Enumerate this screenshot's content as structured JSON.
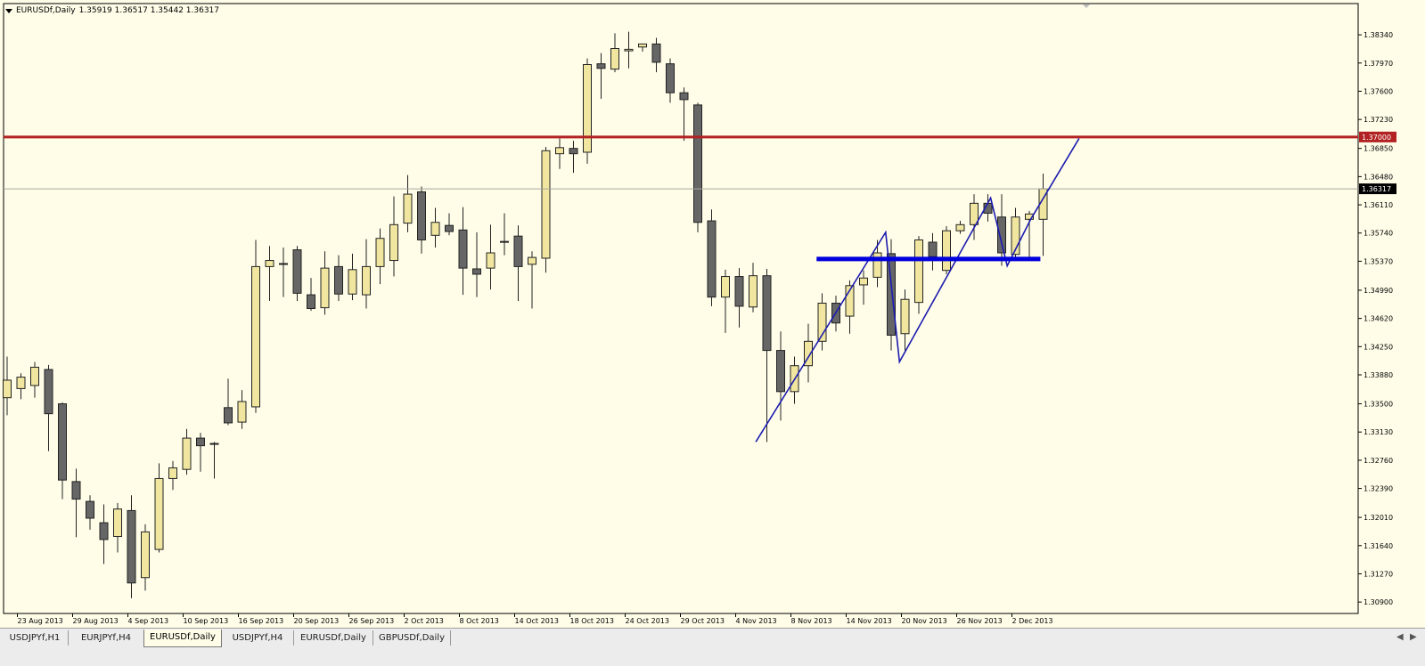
{
  "header": {
    "symbol": "EURUSDf,Daily",
    "ohlc": "1.35919 1.36517 1.35442 1.36317"
  },
  "chart_data": {
    "type": "candlestick",
    "symbol": "EURUSDf",
    "timeframe": "Daily",
    "ylim": [
      1.3075,
      1.3875
    ],
    "y_ticks": [
      "1.38340",
      "1.37970",
      "1.37600",
      "1.37230",
      "1.36850",
      "1.36480",
      "1.36110",
      "1.35740",
      "1.35370",
      "1.34990",
      "1.34620",
      "1.34250",
      "1.33880",
      "1.33500",
      "1.33130",
      "1.32760",
      "1.32390",
      "1.32010",
      "1.31640",
      "1.31270",
      "1.30900"
    ],
    "x_tick_labels": [
      {
        "bar": 1,
        "label": "23 Aug 2013"
      },
      {
        "bar": 5,
        "label": "29 Aug 2013"
      },
      {
        "bar": 9,
        "label": "4 Sep 2013"
      },
      {
        "bar": 13,
        "label": "10 Sep 2013"
      },
      {
        "bar": 17,
        "label": "16 Sep 2013"
      },
      {
        "bar": 21,
        "label": "20 Sep 2013"
      },
      {
        "bar": 25,
        "label": "26 Sep 2013"
      },
      {
        "bar": 29,
        "label": "2 Oct 2013"
      },
      {
        "bar": 33,
        "label": "8 Oct 2013"
      },
      {
        "bar": 37,
        "label": "14 Oct 2013"
      },
      {
        "bar": 41,
        "label": "18 Oct 2013"
      },
      {
        "bar": 45,
        "label": "24 Oct 2013"
      },
      {
        "bar": 49,
        "label": "29 Oct 2013"
      },
      {
        "bar": 53,
        "label": "4 Nov 2013"
      },
      {
        "bar": 57,
        "label": "8 Nov 2013"
      },
      {
        "bar": 61,
        "label": "14 Nov 2013"
      },
      {
        "bar": 65,
        "label": "20 Nov 2013"
      },
      {
        "bar": 69,
        "label": "26 Nov 2013"
      },
      {
        "bar": 73,
        "label": "2 Dec 2013"
      }
    ],
    "ohlc": [
      [
        1.3358,
        1.3412,
        1.3335,
        1.3381
      ],
      [
        1.337,
        1.339,
        1.3356,
        1.3385
      ],
      [
        1.3374,
        1.3405,
        1.3358,
        1.3398
      ],
      [
        1.3395,
        1.3401,
        1.3288,
        1.3337
      ],
      [
        1.335,
        1.3352,
        1.3225,
        1.325
      ],
      [
        1.3248,
        1.3265,
        1.3175,
        1.3225
      ],
      [
        1.3222,
        1.323,
        1.3185,
        1.32
      ],
      [
        1.3194,
        1.3218,
        1.314,
        1.3172
      ],
      [
        1.3176,
        1.322,
        1.3155,
        1.3212
      ],
      [
        1.321,
        1.323,
        1.3095,
        1.3115
      ],
      [
        1.3122,
        1.3192,
        1.3105,
        1.3182
      ],
      [
        1.3159,
        1.3272,
        1.3155,
        1.3252
      ],
      [
        1.3252,
        1.3275,
        1.3237,
        1.3266
      ],
      [
        1.3264,
        1.3317,
        1.3257,
        1.3305
      ],
      [
        1.3305,
        1.3312,
        1.3261,
        1.3295
      ],
      [
        1.3298,
        1.33,
        1.3252,
        1.3298
      ],
      [
        1.3345,
        1.3383,
        1.3322,
        1.3325
      ],
      [
        1.3326,
        1.3368,
        1.3317,
        1.3353
      ],
      [
        1.3346,
        1.3565,
        1.3338,
        1.353
      ],
      [
        1.353,
        1.3557,
        1.3485,
        1.3538
      ],
      [
        1.3534,
        1.3555,
        1.349,
        1.3533
      ],
      [
        1.3552,
        1.3557,
        1.3485,
        1.3495
      ],
      [
        1.3493,
        1.3515,
        1.3472,
        1.3475
      ],
      [
        1.3476,
        1.355,
        1.3467,
        1.3528
      ],
      [
        1.353,
        1.3545,
        1.3485,
        1.3494
      ],
      [
        1.3494,
        1.3547,
        1.3486,
        1.3526
      ],
      [
        1.3493,
        1.3566,
        1.3475,
        1.353
      ],
      [
        1.353,
        1.358,
        1.3507,
        1.3567
      ],
      [
        1.3538,
        1.3622,
        1.3517,
        1.3585
      ],
      [
        1.3587,
        1.365,
        1.3575,
        1.3625
      ],
      [
        1.3628,
        1.3635,
        1.3547,
        1.3565
      ],
      [
        1.3571,
        1.3607,
        1.3555,
        1.3588
      ],
      [
        1.3584,
        1.36,
        1.3571,
        1.3576
      ],
      [
        1.3578,
        1.3608,
        1.3493,
        1.3528
      ],
      [
        1.3527,
        1.3575,
        1.349,
        1.352
      ],
      [
        1.3528,
        1.3585,
        1.35,
        1.3548
      ],
      [
        1.3563,
        1.36,
        1.3545,
        1.3562
      ],
      [
        1.357,
        1.3584,
        1.3485,
        1.353
      ],
      [
        1.3533,
        1.355,
        1.3475,
        1.3542
      ],
      [
        1.3541,
        1.3687,
        1.3522,
        1.3682
      ],
      [
        1.3678,
        1.3698,
        1.3658,
        1.3686
      ],
      [
        1.3685,
        1.3695,
        1.3653,
        1.3678
      ],
      [
        1.368,
        1.3803,
        1.3665,
        1.3795
      ],
      [
        1.3796,
        1.381,
        1.375,
        1.379
      ],
      [
        1.3789,
        1.3836,
        1.3785,
        1.3816
      ],
      [
        1.3813,
        1.3838,
        1.379,
        1.3815
      ],
      [
        1.3818,
        1.3822,
        1.3812,
        1.3822
      ],
      [
        1.3822,
        1.383,
        1.3785,
        1.3798
      ],
      [
        1.3796,
        1.3803,
        1.3745,
        1.3758
      ],
      [
        1.3758,
        1.3765,
        1.3695,
        1.3749
      ],
      [
        1.3742,
        1.3745,
        1.3575,
        1.3588
      ],
      [
        1.359,
        1.3605,
        1.3478,
        1.349
      ],
      [
        1.349,
        1.3526,
        1.3443,
        1.3517
      ],
      [
        1.3517,
        1.3528,
        1.345,
        1.3478
      ],
      [
        1.3477,
        1.3535,
        1.347,
        1.3518
      ],
      [
        1.3518,
        1.3527,
        1.33,
        1.342
      ],
      [
        1.342,
        1.3445,
        1.3328,
        1.3366
      ],
      [
        1.3366,
        1.3412,
        1.335,
        1.34
      ],
      [
        1.34,
        1.3455,
        1.3378,
        1.3432
      ],
      [
        1.3432,
        1.3495,
        1.342,
        1.3482
      ],
      [
        1.3482,
        1.3492,
        1.3445,
        1.3456
      ],
      [
        1.3465,
        1.3512,
        1.3442,
        1.3505
      ],
      [
        1.3506,
        1.3525,
        1.348,
        1.3515
      ],
      [
        1.3516,
        1.3565,
        1.3503,
        1.3548
      ],
      [
        1.3547,
        1.3566,
        1.342,
        1.344
      ],
      [
        1.3442,
        1.35,
        1.342,
        1.3487
      ],
      [
        1.3483,
        1.357,
        1.3468,
        1.3565
      ],
      [
        1.3562,
        1.3574,
        1.3525,
        1.3543
      ],
      [
        1.3525,
        1.3583,
        1.352,
        1.3577
      ],
      [
        1.3577,
        1.359,
        1.3573,
        1.3585
      ],
      [
        1.3585,
        1.3625,
        1.3565,
        1.3613
      ],
      [
        1.3613,
        1.3625,
        1.3589,
        1.36
      ],
      [
        1.3595,
        1.3625,
        1.3531,
        1.3548
      ],
      [
        1.3546,
        1.3607,
        1.3538,
        1.3595
      ],
      [
        1.3592,
        1.3603,
        1.354,
        1.3599
      ],
      [
        1.3592,
        1.3652,
        1.3544,
        1.3632
      ]
    ],
    "horizontal_lines": [
      {
        "price": 1.37,
        "color": "#b22222",
        "label": "1.37000"
      },
      {
        "price": 1.3632,
        "color": "#a8a8a0",
        "label": "1.36317"
      }
    ],
    "trendlines": [
      {
        "points": [
          [
            54.2,
            1.33
          ],
          [
            63.6,
            1.3575
          ],
          [
            64.6,
            1.3405
          ],
          [
            71.2,
            1.362
          ],
          [
            72.4,
            1.3531
          ],
          [
            74.1,
            1.3592
          ],
          [
            77.6,
            1.3698
          ]
        ],
        "color": "#1c1cb0",
        "style": "zigzag"
      },
      {
        "points": [
          [
            58.6,
            1.354
          ],
          [
            74.8,
            1.354
          ]
        ],
        "color": "#0000dd",
        "style": "thick"
      }
    ],
    "colors": {
      "background": "#fffde8",
      "bull": "#f0e6a0",
      "bear": "#666666",
      "wick": "#222222"
    }
  },
  "tabs": [
    {
      "label": "USDJPYf,H1"
    },
    {
      "label": "EURJPYf,H4"
    },
    {
      "label": "EURUSDf,Daily"
    },
    {
      "label": "USDJPYf,H4"
    },
    {
      "label": "EURUSDf,Daily"
    },
    {
      "label": "GBPUSDf,Daily"
    }
  ]
}
